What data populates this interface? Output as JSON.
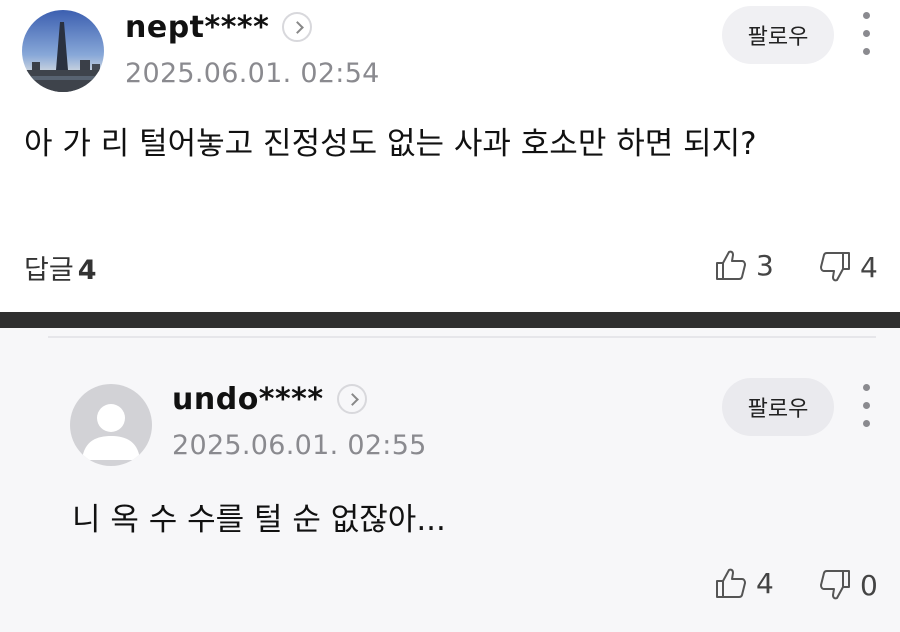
{
  "comment": {
    "username": "nept****",
    "timestamp": "2025.06.01. 02:54",
    "follow_label": "팔로우",
    "text": "아 가 리 털어놓고 진정성도 없는 사과 호소만 하면 되지?",
    "reply_label": "답글",
    "reply_count": "4",
    "likes": "3",
    "dislikes": "4"
  },
  "reply": {
    "username": "undo****",
    "timestamp": "2025.06.01. 02:55",
    "follow_label": "팔로우",
    "text": "니 옥 수 수를 털 순 없잖아...",
    "likes": "4",
    "dislikes": "0"
  },
  "colors": {
    "separator": "#2f2f2f",
    "reply_background": "#f7f7f9",
    "meta_text": "#8a8a8f"
  },
  "icons": [
    "profile-photo",
    "chevron-right-icon",
    "more-vertical-icon",
    "thumbs-up-icon",
    "thumbs-down-icon",
    "default-avatar-icon"
  ]
}
